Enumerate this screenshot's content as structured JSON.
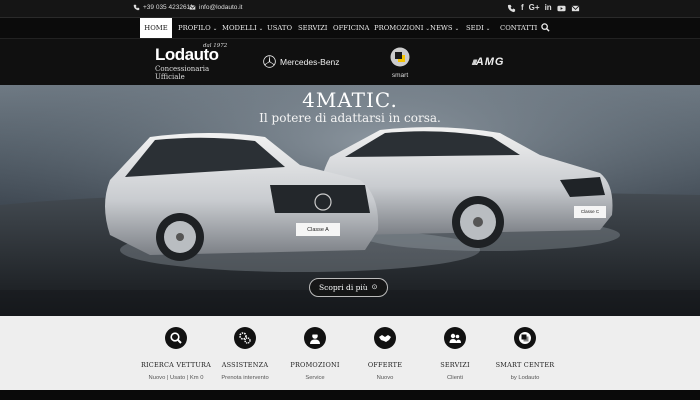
{
  "topbar": {
    "phone": "+39 035 4232611",
    "email": "info@lodauto.it",
    "socials": [
      "phone-icon",
      "facebook-icon",
      "google-plus-icon",
      "linkedin-icon",
      "youtube-icon",
      "mail-icon"
    ]
  },
  "nav": {
    "items": [
      {
        "label": "HOME",
        "active": true
      },
      {
        "label": "PROFILO",
        "dropdown": true
      },
      {
        "label": "MODELLI",
        "dropdown": true
      },
      {
        "label": "USATO"
      },
      {
        "label": "SERVIZI"
      },
      {
        "label": "OFFICINA"
      },
      {
        "label": "PROMOZIONI",
        "dropdown": true
      },
      {
        "label": "NEWS",
        "dropdown": true
      },
      {
        "label": "SEDI",
        "dropdown": true
      },
      {
        "label": "CONTATTI"
      }
    ],
    "search_icon": "search-icon"
  },
  "brands": {
    "lodauto": {
      "name": "Lodauto",
      "since": "dal 1972",
      "subtitle": "Concessionaria Ufficiale"
    },
    "mercedes": "Mercedes-Benz",
    "smart": "smart",
    "amg": "AMG"
  },
  "hero": {
    "title": "4MATIC.",
    "subtitle": "Il potere di adattarsi in corsa.",
    "plate_left": "Classe A",
    "plate_right": "Classe C",
    "cta": "Scopri di più"
  },
  "services": [
    {
      "title": "RICERCA VETTURA",
      "sub": "Nuovo | Usato | Km 0",
      "icon": "search-icon"
    },
    {
      "title": "ASSISTENZA",
      "sub": "Prenota intervento",
      "icon": "gears-icon"
    },
    {
      "title": "PROMOZIONI",
      "sub": "Service",
      "icon": "mechanic-icon"
    },
    {
      "title": "OFFERTE",
      "sub": "Nuovo",
      "icon": "handshake-icon"
    },
    {
      "title": "SERVIZI",
      "sub": "Clienti",
      "icon": "people-icon"
    },
    {
      "title": "SMART CENTER",
      "sub": "by Lodauto",
      "icon": "smart-logo-icon"
    }
  ],
  "colors": {
    "nav_bg": "#0b0b0b",
    "services_bg": "#eeeeee",
    "active_tab": "#ffffff"
  }
}
